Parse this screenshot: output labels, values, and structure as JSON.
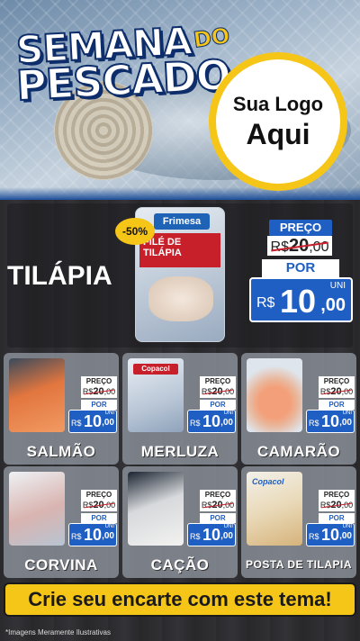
{
  "header": {
    "title_line1": "SEMANA",
    "title_do": "DO",
    "title_line2": "PESCADO",
    "logo_line1": "Sua Logo",
    "logo_line2": "Aqui",
    "colors": {
      "accent_yellow": "#f5c518",
      "brand_blue": "#1f5fc4",
      "title_stroke": "#0d2d6b"
    }
  },
  "hero": {
    "name": "TILÁPIA",
    "discount": "-50%",
    "package_brand": "Frimesa",
    "package_label": "FILÉ DE TILÁPIA",
    "price_label": "PREÇO",
    "old_price_prefix": "R$",
    "old_price_int": "20",
    "old_price_dec": ",00",
    "por_label": "POR",
    "currency": "R$",
    "new_price_int": "10",
    "new_price_dec": ",00",
    "unit": "UNI"
  },
  "products": [
    {
      "name": "SALMÃO",
      "price_label": "PREÇO",
      "old_prefix": "R$",
      "old_int": "20",
      "old_dec": ",00",
      "por_label": "POR",
      "currency": "R$",
      "new_int": "10",
      "new_dec": ",00",
      "unit": "UNI"
    },
    {
      "name": "MERLUZA",
      "price_label": "PREÇO",
      "old_prefix": "R$",
      "old_int": "20",
      "old_dec": ",00",
      "por_label": "POR",
      "currency": "R$",
      "new_int": "10",
      "new_dec": ",00",
      "unit": "UNI",
      "brand": "Copacol"
    },
    {
      "name": "CAMARÃO",
      "price_label": "PREÇO",
      "old_prefix": "R$",
      "old_int": "20",
      "old_dec": ",00",
      "por_label": "POR",
      "currency": "R$",
      "new_int": "10",
      "new_dec": ",00",
      "unit": "UNI"
    },
    {
      "name": "CORVINA",
      "price_label": "PREÇO",
      "old_prefix": "R$",
      "old_int": "20",
      "old_dec": ",00",
      "por_label": "POR",
      "currency": "R$",
      "new_int": "10",
      "new_dec": ",00",
      "unit": "UNI"
    },
    {
      "name": "CAÇÃO",
      "price_label": "PREÇO",
      "old_prefix": "R$",
      "old_int": "20",
      "old_dec": ",00",
      "por_label": "POR",
      "currency": "R$",
      "new_int": "10",
      "new_dec": ",00",
      "unit": "UNI"
    },
    {
      "name": "POSTA DE TILAPIA",
      "price_label": "PREÇO",
      "old_prefix": "R$",
      "old_int": "20",
      "old_dec": ",00",
      "por_label": "POR",
      "currency": "R$",
      "new_int": "10",
      "new_dec": ",00",
      "unit": "UNI",
      "brand": "Copacol"
    }
  ],
  "banner": {
    "text": "Crie seu encarte com este tema!"
  },
  "footnote": "*Imagens Meramente Ilustrativas"
}
